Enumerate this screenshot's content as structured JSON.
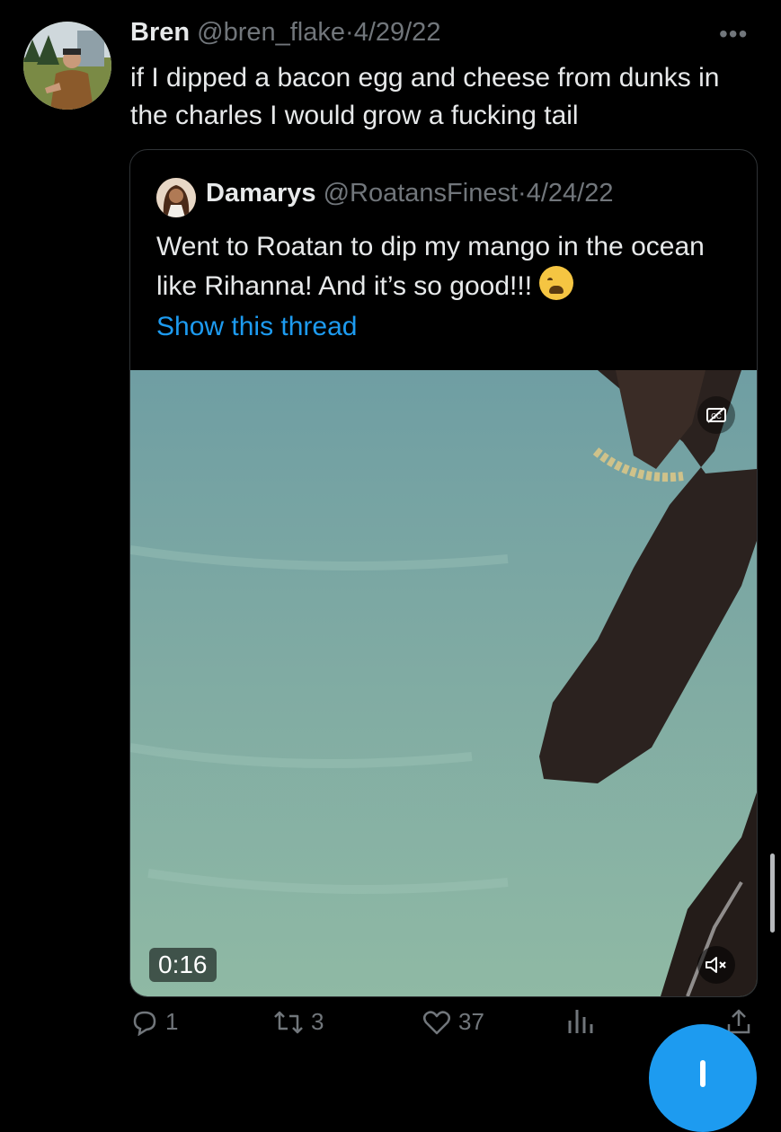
{
  "tweet": {
    "author_name": "Bren",
    "handle": "@bren_flake",
    "separator": "·",
    "date": "4/29/22",
    "more_label": "•••",
    "text": "if I dipped a bacon egg and cheese from dunks in the charles I would grow a fucking tail"
  },
  "quoted_tweet": {
    "author_name": "Damarys",
    "handle": "@RoatansFinest",
    "separator": "·",
    "date": "4/24/22",
    "text": "Went to Roatan to dip my mango in the ocean like Rihanna! And it’s so good!!!",
    "emoji_icon": "weary-face-icon",
    "show_thread_label": "Show this thread",
    "video": {
      "duration": "0:16",
      "captions_icon": "captions-off-icon",
      "mute_icon": "muted-speaker-icon"
    }
  },
  "actions": {
    "reply_count": "1",
    "retweet_count": "3",
    "like_count": "37"
  },
  "colors": {
    "background": "#000000",
    "text": "#e7e9ea",
    "muted": "#71767b",
    "accent": "#1d9bf0",
    "border": "#2f3336"
  }
}
